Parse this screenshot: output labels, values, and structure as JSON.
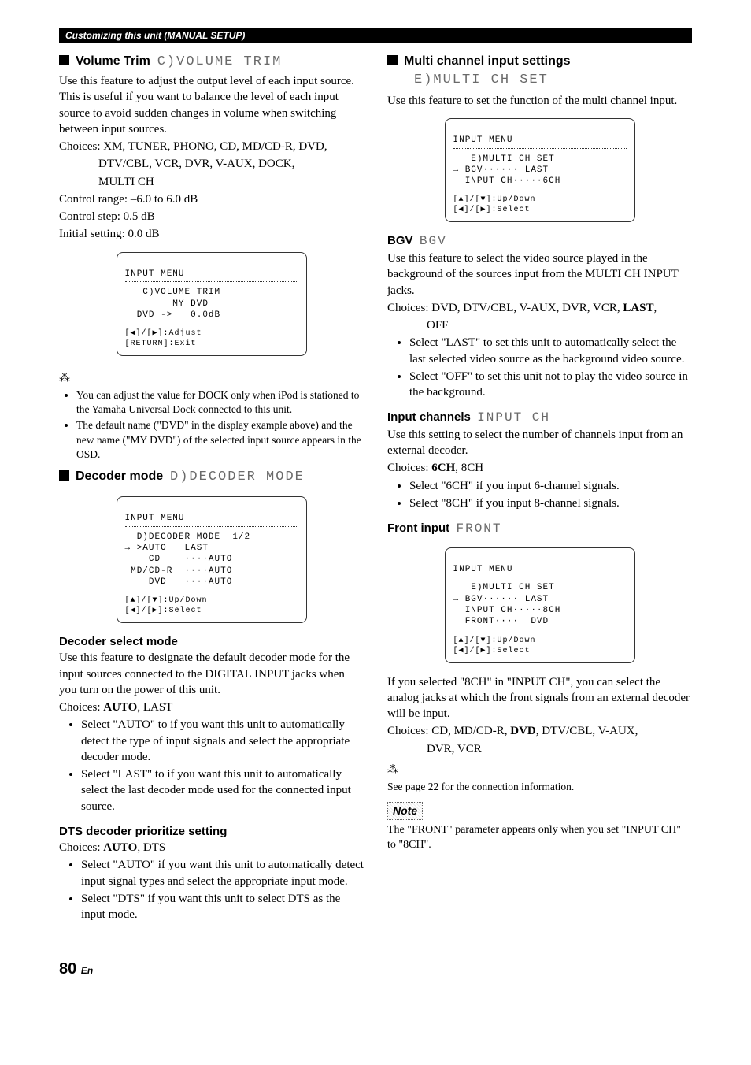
{
  "header": "Customizing this unit (MANUAL SETUP)",
  "left": {
    "volTrim": {
      "title": "Volume Trim",
      "osd": "C)VOLUME TRIM",
      "desc": "Use this feature to adjust the output level of each input source. This is useful if you want to balance the level of each input source to avoid sudden changes in volume when switching between input sources.",
      "choicesLabel": "Choices: XM, TUNER, PHONO, CD, MD/CD-R, DVD,",
      "choices2": "DTV/CBL, VCR, DVR, V-AUX, DOCK,",
      "choices3": "MULTI CH",
      "range": "Control range: –6.0 to 6.0 dB",
      "step": "Control step: 0.5 dB",
      "init": "Initial setting: 0.0 dB",
      "panel": {
        "title": "INPUT MENU",
        "l1": "   C)VOLUME TRIM",
        "l2": "        MY DVD",
        "l3": "  DVD ->   0.0dB",
        "nav1": "[◀]/[▶]:Adjust",
        "nav2": "[RETURN]:Exit"
      },
      "tip1": "You can adjust the value for DOCK only when iPod is stationed to the Yamaha Universal Dock connected to this unit.",
      "tip2": "The default name (\"DVD\" in the display example above) and the new name (\"MY DVD\") of the selected input source appears in the OSD."
    },
    "decoder": {
      "title": "Decoder mode",
      "osd": "D)DECODER MODE",
      "panel": {
        "title": "INPUT MENU",
        "l1": "  D)DECODER MODE  1/2",
        "l2": "→ >AUTO   LAST",
        "l3": "    CD    ····AUTO",
        "l4": " MD/CD-R  ····AUTO",
        "l5": "    DVD   ····AUTO",
        "nav1": "[▲]/[▼]:Up/Down",
        "nav2": "[◀]/[▶]:Select"
      },
      "selTitle": "Decoder select mode",
      "selDesc": "Use this feature to designate the default decoder mode for the input sources connected to the DIGITAL INPUT jacks when you turn on the power of this unit.",
      "selChoicesPre": "Choices: ",
      "selChoicesBold": "AUTO",
      "selChoicesPost": ", LAST",
      "b1": "Select \"AUTO\" to if you want this unit to automatically detect the type of input signals and select the appropriate decoder mode.",
      "b2": "Select \"LAST\" to if you want this unit to automatically select the last decoder mode used for the connected input source.",
      "dtsTitle": "DTS decoder prioritize setting",
      "dtsChoicesPre": "Choices: ",
      "dtsChoicesBold": "AUTO",
      "dtsChoicesPost": ", DTS",
      "d1": "Select \"AUTO\" if you want this unit to automatically detect input signal types and select the appropriate input mode.",
      "d2": "Select \"DTS\" if you want this unit to select DTS as the input mode."
    }
  },
  "right": {
    "multi": {
      "title": "Multi channel input settings",
      "osd": "E)MULTI CH SET",
      "desc": "Use this feature to set the function of the multi channel input.",
      "panel": {
        "title": "INPUT MENU",
        "l1": "   E)MULTI CH SET",
        "l2": "→ BGV······ LAST",
        "l3": "  INPUT CH·····6CH",
        "nav1": "[▲]/[▼]:Up/Down",
        "nav2": "[◀]/[▶]:Select"
      }
    },
    "bgv": {
      "title": "BGV",
      "osd": "BGV",
      "desc": "Use this feature to select the video source played in the background of the sources input from the MULTI CH INPUT jacks.",
      "choicesPre": "Choices: DVD, DTV/CBL, V-AUX, DVR, VCR, ",
      "choicesBold": "LAST",
      "choicesPost": ",",
      "choices2": "OFF",
      "b1": "Select \"LAST\" to set this unit to automatically select the last selected video source as the background video source.",
      "b2": "Select \"OFF\" to set this unit not to play the video source in the background."
    },
    "inputCh": {
      "title": "Input channels",
      "osd": "INPUT CH",
      "desc": "Use this setting to select the number of channels input from an external decoder.",
      "choicesPre": "Choices: ",
      "choicesBold": "6CH",
      "choicesPost": ", 8CH",
      "b1": "Select \"6CH\" if you input 6-channel signals.",
      "b2": "Select \"8CH\" if you input 8-channel signals."
    },
    "front": {
      "title": "Front input",
      "osd": "FRONT",
      "panel": {
        "title": "INPUT MENU",
        "l1": "   E)MULTI CH SET",
        "l2": "→ BGV······ LAST",
        "l3": "  INPUT CH·····8CH",
        "l4": "  FRONT····  DVD",
        "nav1": "[▲]/[▼]:Up/Down",
        "nav2": "[◀]/[▶]:Select"
      },
      "desc": "If you selected \"8CH\" in \"INPUT CH\", you can select the analog jacks at which the front signals from an external decoder will be input.",
      "choicesPre": "Choices: CD, MD/CD-R, ",
      "choicesBold": "DVD",
      "choicesPost": ", DTV/CBL, V-AUX,",
      "choices2": "DVR, VCR",
      "tip": "See page 22 for the connection information.",
      "noteLabel": "Note",
      "note": "The \"FRONT\" parameter appears only when you set \"INPUT CH\" to \"8CH\"."
    }
  },
  "page": "80",
  "pageSuffix": "En"
}
